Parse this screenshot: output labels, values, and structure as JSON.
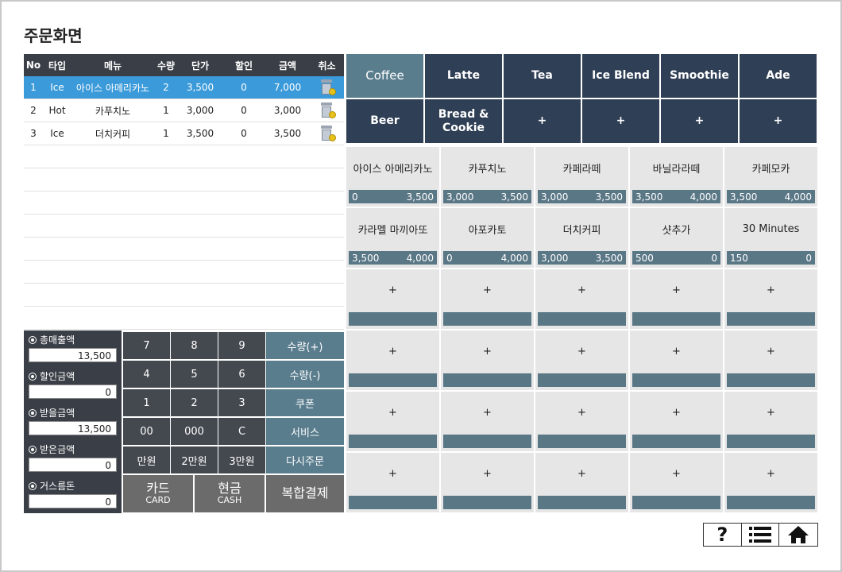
{
  "title": "주문화면",
  "order": {
    "headers": [
      "No",
      "타입",
      "메뉴",
      "수량",
      "단가",
      "할인",
      "금액",
      "취소"
    ],
    "rows": [
      {
        "no": "1",
        "type": "Ice",
        "menu": "아이스 아메리카노",
        "qty": "2",
        "price": "3,500",
        "discount": "0",
        "amount": "7,000"
      },
      {
        "no": "2",
        "type": "Hot",
        "menu": "카푸치노",
        "qty": "1",
        "price": "3,000",
        "discount": "0",
        "amount": "3,000"
      },
      {
        "no": "3",
        "type": "Ice",
        "menu": "더치커피",
        "qty": "1",
        "price": "3,500",
        "discount": "0",
        "amount": "3,500"
      }
    ]
  },
  "totals": [
    {
      "label": "총매출액",
      "value": "13,500"
    },
    {
      "label": "할인금액",
      "value": "0"
    },
    {
      "label": "받을금액",
      "value": "13,500"
    },
    {
      "label": "받은금액",
      "value": "0"
    },
    {
      "label": "거스름돈",
      "value": "0"
    }
  ],
  "keypad": {
    "keys": [
      "7",
      "8",
      "9",
      "4",
      "5",
      "6",
      "1",
      "2",
      "3",
      "00",
      "000",
      "C",
      "만원",
      "2만원",
      "3만원"
    ],
    "side": [
      "수량(+)",
      "수량(-)",
      "쿠폰",
      "서비스",
      "다시주문"
    ],
    "card_label": "카드",
    "card_sub": "CARD",
    "cash_label": "현금",
    "cash_sub": "CASH",
    "mixed_label": "복합결제"
  },
  "categories": [
    "Coffee",
    "Latte",
    "Tea",
    "Ice Blend",
    "Smoothie",
    "Ade",
    "Beer",
    "Bread & Cookie",
    "+",
    "+",
    "+",
    "+"
  ],
  "active_category": "Coffee",
  "menu_items": [
    {
      "name": "아이스 아메리카노",
      "left": "0",
      "right": "3,500"
    },
    {
      "name": "카푸치노",
      "left": "3,000",
      "right": "3,500"
    },
    {
      "name": "카페라떼",
      "left": "3,000",
      "right": "3,500"
    },
    {
      "name": "바닐라라떼",
      "left": "3,500",
      "right": "4,000"
    },
    {
      "name": "카페모카",
      "left": "3,500",
      "right": "4,000"
    },
    {
      "name": "카라멜 마끼아또",
      "left": "3,500",
      "right": "4,000"
    },
    {
      "name": "아포카토",
      "left": "0",
      "right": "4,000"
    },
    {
      "name": "더치커피",
      "left": "3,000",
      "right": "3,500"
    },
    {
      "name": "샷추가",
      "left": "500",
      "right": "0"
    },
    {
      "name": "30 Minutes",
      "left": "150",
      "right": "0"
    },
    {
      "name": "+",
      "left": "",
      "right": ""
    },
    {
      "name": "+",
      "left": "",
      "right": ""
    },
    {
      "name": "+",
      "left": "",
      "right": ""
    },
    {
      "name": "+",
      "left": "",
      "right": ""
    },
    {
      "name": "+",
      "left": "",
      "right": ""
    },
    {
      "name": "+",
      "left": "",
      "right": ""
    },
    {
      "name": "+",
      "left": "",
      "right": ""
    },
    {
      "name": "+",
      "left": "",
      "right": ""
    },
    {
      "name": "+",
      "left": "",
      "right": ""
    },
    {
      "name": "+",
      "left": "",
      "right": ""
    },
    {
      "name": "+",
      "left": "",
      "right": ""
    },
    {
      "name": "+",
      "left": "",
      "right": ""
    },
    {
      "name": "+",
      "left": "",
      "right": ""
    },
    {
      "name": "+",
      "left": "",
      "right": ""
    },
    {
      "name": "+",
      "left": "",
      "right": ""
    },
    {
      "name": "+",
      "left": "",
      "right": ""
    },
    {
      "name": "+",
      "left": "",
      "right": ""
    },
    {
      "name": "+",
      "left": "",
      "right": ""
    },
    {
      "name": "+",
      "left": "",
      "right": ""
    },
    {
      "name": "+",
      "left": "",
      "right": ""
    }
  ],
  "icons": [
    "help-icon",
    "list-icon",
    "home-icon"
  ],
  "colors": {
    "selected_row": "#3b9ad9",
    "active_category": "#5a7d8e",
    "category": "#2f3f55",
    "price_bar": "#5a7786"
  }
}
